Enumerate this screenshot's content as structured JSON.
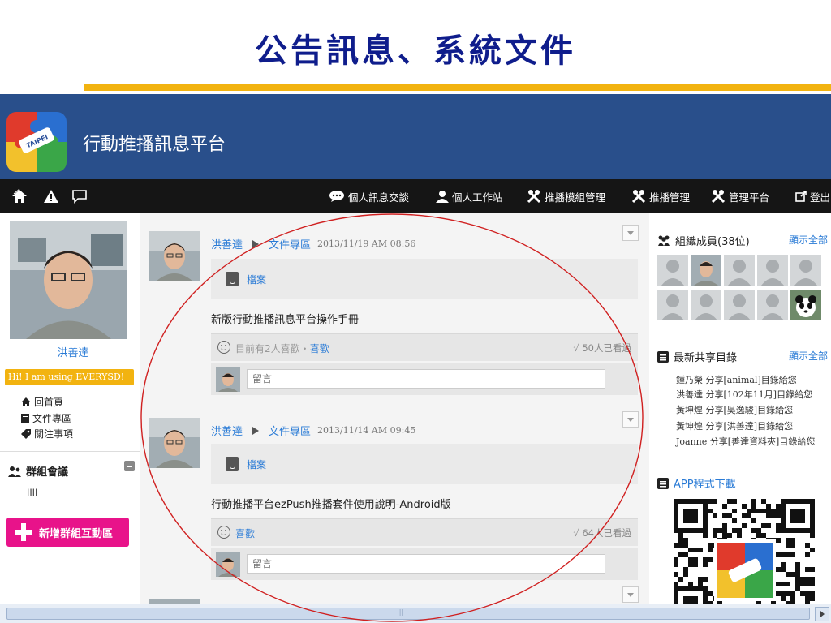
{
  "slide": {
    "title": "公告訊息、系統文件"
  },
  "app": {
    "title": "行動推播訊息平台"
  },
  "nav": {
    "items": [
      {
        "label": "個人訊息交談",
        "icon": "chat-bubble-icon"
      },
      {
        "label": "個人工作站",
        "icon": "person-icon"
      },
      {
        "label": "推播模組管理",
        "icon": "tools-icon"
      },
      {
        "label": "推播管理",
        "icon": "tools-icon"
      },
      {
        "label": "管理平台",
        "icon": "tools-icon"
      },
      {
        "label": "登出",
        "icon": "external-link-icon"
      }
    ]
  },
  "profile": {
    "name": "洪善達",
    "status": "Hi! I am using EVERYSD!",
    "links": [
      {
        "label": "回首頁",
        "icon": "home-icon"
      },
      {
        "label": "文件專區",
        "icon": "document-icon"
      },
      {
        "label": "關注事項",
        "icon": "tag-icon"
      }
    ]
  },
  "groups": {
    "header": "群組會議",
    "items": [
      "llll"
    ],
    "new_button": "新增群組互動區"
  },
  "feed": {
    "posts": [
      {
        "author": "洪善達",
        "area": "文件專區",
        "time": "2013/11/19 AM 08:56",
        "attachment": "檔案",
        "body": "新版行動推播訊息平台操作手冊",
        "likes_prefix": "目前有2人喜歡・",
        "like_link": "喜歡",
        "views": "√ 50人已看過",
        "comment_placeholder": "留言"
      },
      {
        "author": "洪善達",
        "area": "文件專區",
        "time": "2013/11/14 AM 09:45",
        "attachment": "檔案",
        "body": "行動推播平台ezPush推播套件使用說明-Android版",
        "likes_prefix": "",
        "like_link": "喜歡",
        "views": "√ 64人已看過",
        "comment_placeholder": "留言"
      }
    ]
  },
  "sidebar_right": {
    "members": {
      "title": "組織成員(38位)",
      "show_all": "顯示全部"
    },
    "shares": {
      "title": "最新共享目錄",
      "show_all": "顯示全部",
      "items": [
        "鍾乃榮 分享[animal]目錄給您",
        "洪善達 分享[102年11月]目錄給您",
        "黃坤煌 分享[吳逸駿]目錄給您",
        "黃坤煌 分享[洪善達]目錄給您",
        "Joanne 分享[善達資料夾]目錄給您"
      ]
    },
    "app_download": "APP程式下載"
  },
  "colors": {
    "title_blue": "#0f1d8c",
    "accent_gold": "#f2b310",
    "banner_blue": "#294f8b",
    "nav_black": "#151515",
    "link_blue": "#2a7bd6",
    "button_pink": "#e8138a",
    "annotation_red": "#d02020"
  }
}
